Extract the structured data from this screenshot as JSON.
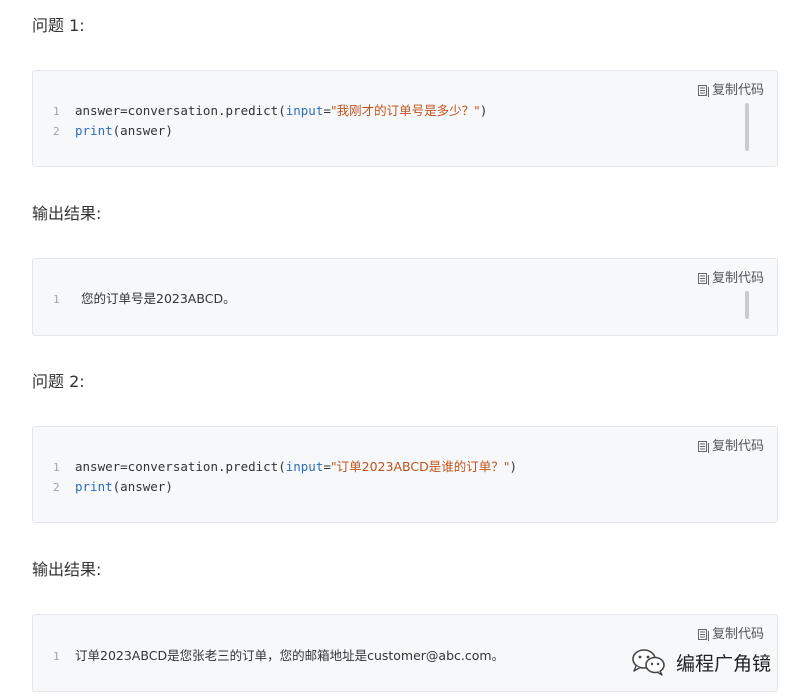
{
  "headings": {
    "q1": "问题 1:",
    "out1": "输出结果:",
    "q2": "问题 2:",
    "out2": "输出结果:"
  },
  "copy_label": "复制代码",
  "blocks": {
    "b1": {
      "lines": [
        {
          "num": "1",
          "a": "answer=conversation.predict(",
          "kw": "input",
          "b": "=",
          "str": "\"我刚才的订单号是多少？\"",
          "c": ")"
        },
        {
          "num": "2",
          "kw": "print",
          "c": "(answer)"
        }
      ]
    },
    "b2": {
      "lines": [
        {
          "num": "1",
          "text": "您的订单号是2023ABCD。"
        }
      ]
    },
    "b3": {
      "lines": [
        {
          "num": "1",
          "a": "answer=conversation.predict(",
          "kw": "input",
          "b": "=",
          "str": "\"订单2023ABCD是谁的订单？\"",
          "c": ")"
        },
        {
          "num": "2",
          "kw": "print",
          "c": "(answer)"
        }
      ]
    },
    "b4": {
      "lines": [
        {
          "num": "1",
          "text": "订单2023ABCD是您张老三的订单，您的邮箱地址是customer@abc.com。"
        }
      ]
    }
  },
  "watermark": "编程广角镜",
  "colors": {
    "keyword": "#2c6db8",
    "string": "#c0541d",
    "block_bg": "#f7f8fa"
  }
}
